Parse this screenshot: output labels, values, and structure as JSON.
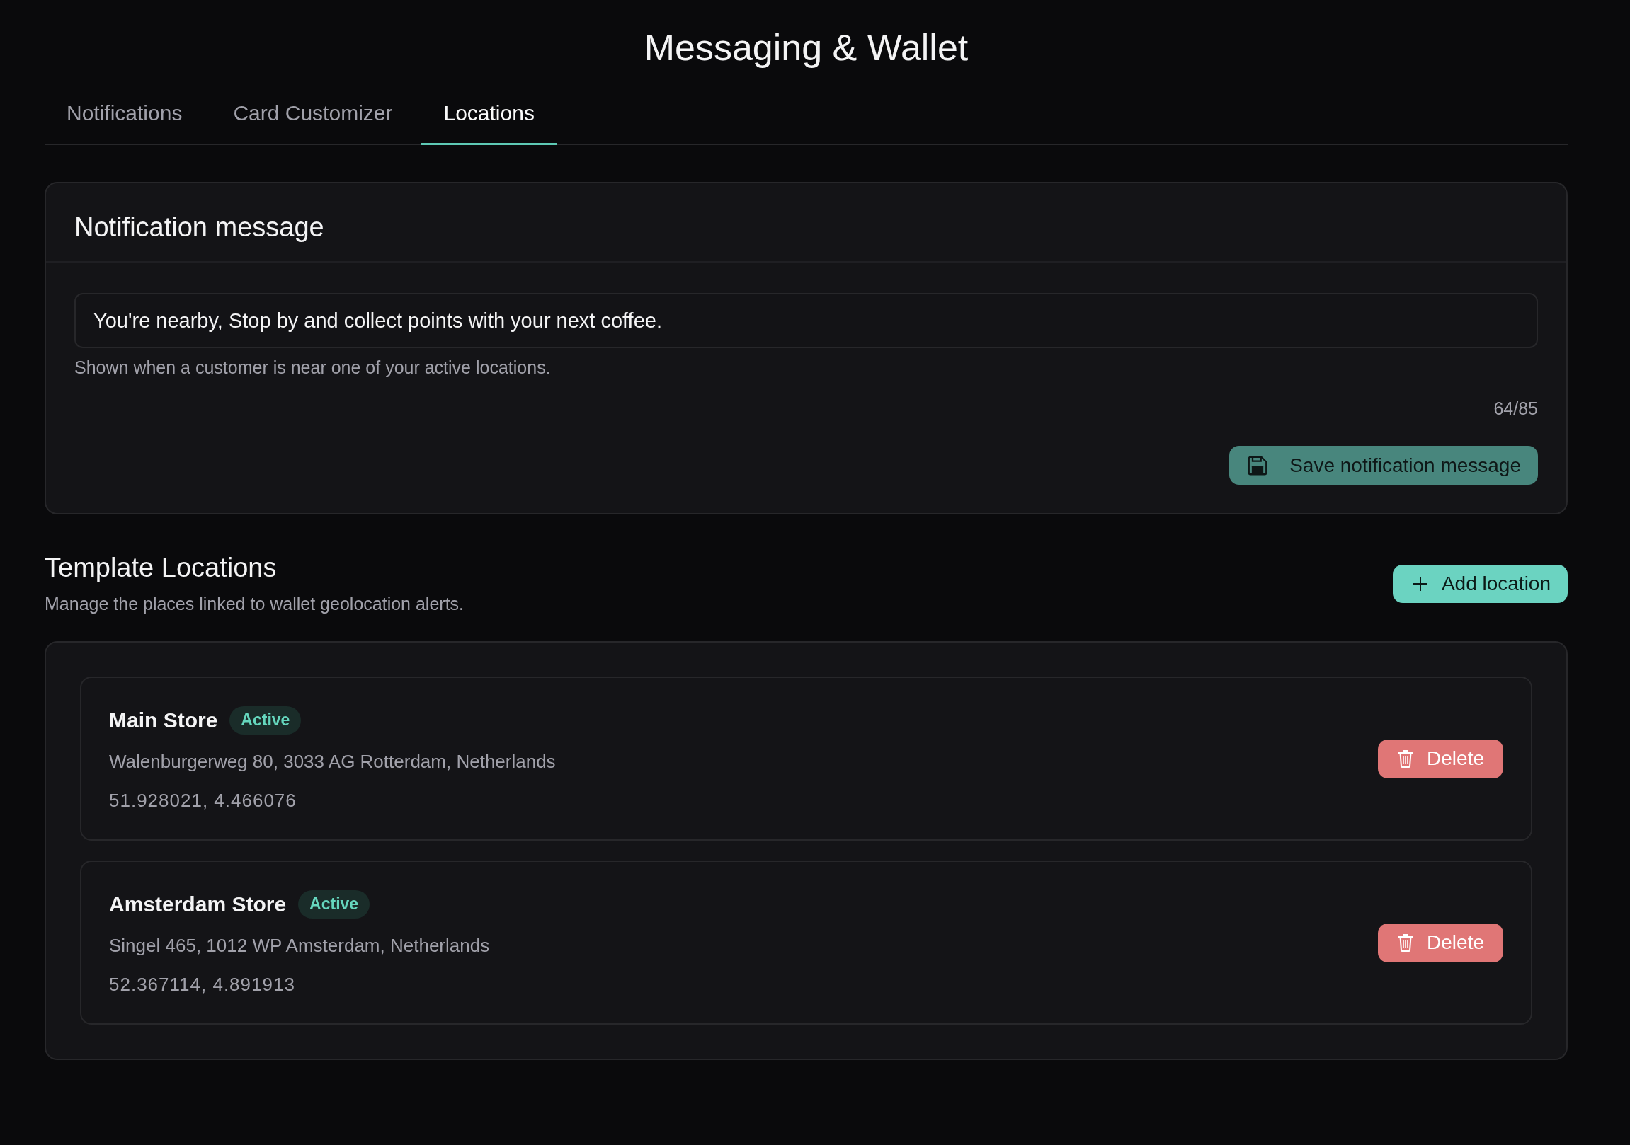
{
  "page": {
    "title": "Messaging & Wallet"
  },
  "tabs": [
    {
      "label": "Notifications",
      "selected": false
    },
    {
      "label": "Card Customizer",
      "selected": false
    },
    {
      "label": "Locations",
      "selected": true
    }
  ],
  "notification_message": {
    "title": "Notification message",
    "message": {
      "value": "You're nearby, Stop by and collect points with your next coffee."
    },
    "helper_text": "Shown when a customer is near one of your active locations.",
    "counter": "64/85",
    "save_button": {
      "label": "Save notification message",
      "disabled": true
    }
  },
  "template_locations": {
    "title": "Template Locations",
    "subtitle": "Manage the places linked to wallet geolocation alerts.",
    "add_button": {
      "label": "Add location"
    },
    "locations": [
      {
        "name": "Main Store",
        "status": "Active",
        "address": "Walenburgerweg 80, 3033 AG Rotterdam, Netherlands",
        "coordinates": "51.928021, 4.466076",
        "delete_button": "Delete"
      },
      {
        "name": "Amsterdam Store",
        "status": "Active",
        "address": "Singel 465, 1012 WP Amsterdam, Netherlands",
        "coordinates": "52.367114, 4.891913",
        "delete_button": "Delete"
      }
    ]
  }
}
